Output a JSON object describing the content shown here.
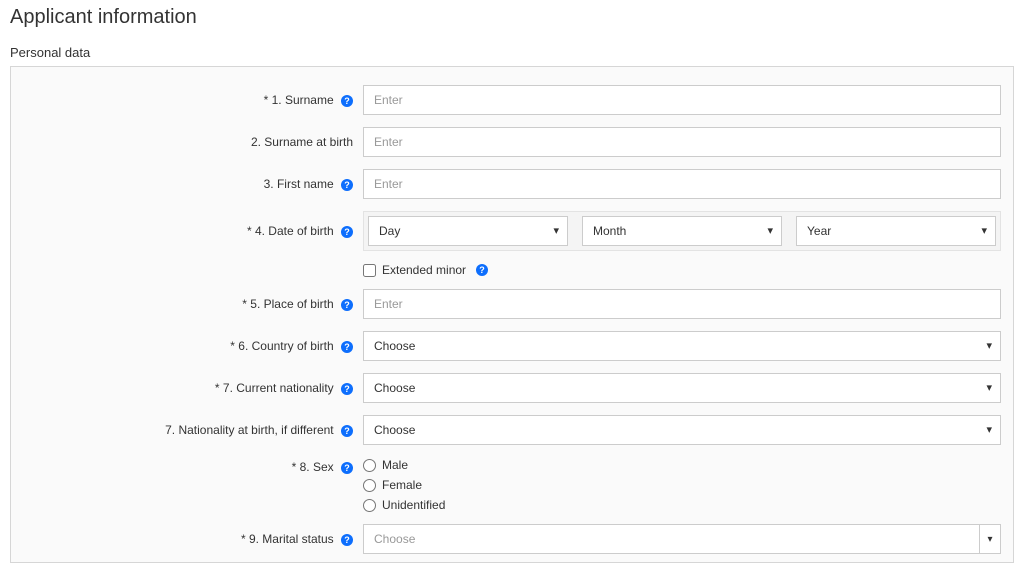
{
  "page": {
    "title": "Applicant information",
    "section": "Personal data"
  },
  "placeholders": {
    "enter": "Enter",
    "choose": "Choose"
  },
  "fields": {
    "surname": {
      "label": "* 1. Surname",
      "has_info": true
    },
    "surname_birth": {
      "label": "2. Surname at birth",
      "has_info": false
    },
    "first_name": {
      "label": "3. First name",
      "has_info": true
    },
    "dob": {
      "label": "* 4. Date of birth",
      "has_info": true,
      "day": "Day",
      "month": "Month",
      "year": "Year"
    },
    "extended_minor": {
      "label": "Extended minor",
      "has_info": true
    },
    "place_birth": {
      "label": "* 5. Place of birth",
      "has_info": true
    },
    "country_birth": {
      "label": "* 6. Country of birth",
      "has_info": true
    },
    "current_nationality": {
      "label": "* 7. Current nationality",
      "has_info": true
    },
    "nationality_birth": {
      "label": "7. Nationality at birth, if different",
      "has_info": true
    },
    "sex": {
      "label": "* 8. Sex",
      "has_info": true,
      "options": {
        "male": "Male",
        "female": "Female",
        "unidentified": "Unidentified"
      }
    },
    "marital_status": {
      "label": "* 9. Marital status",
      "has_info": true
    }
  },
  "icons": {
    "info_glyph": "?"
  }
}
